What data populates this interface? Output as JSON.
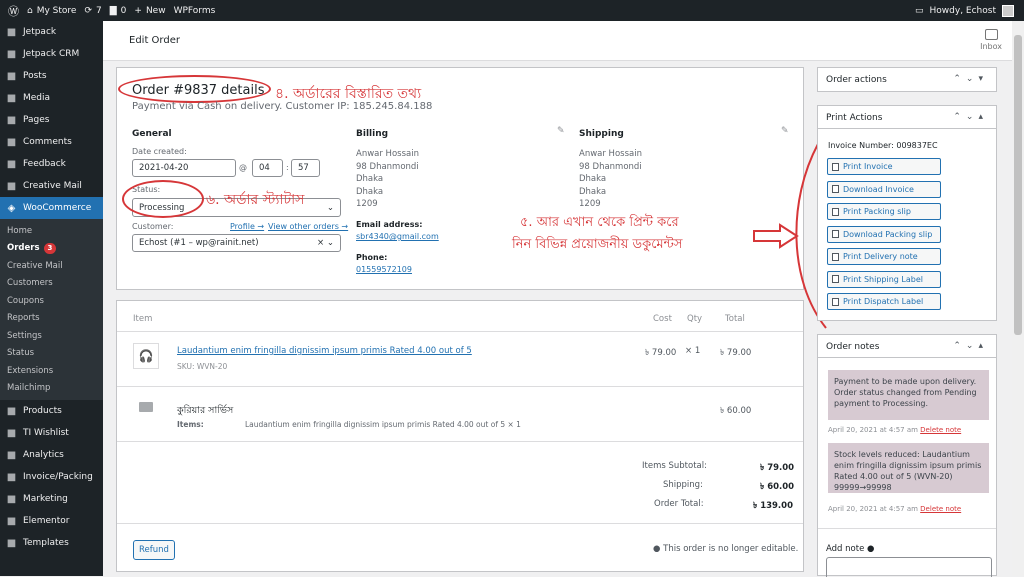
{
  "adminbar": {
    "site": "My Store",
    "updates": "7",
    "comments": "0",
    "new": "New",
    "wpforms": "WPForms",
    "howdy": "Howdy, Echost"
  },
  "sidebar": {
    "top": [
      {
        "label": "Jetpack",
        "icon": "jetpack-icon"
      },
      {
        "label": "Jetpack CRM",
        "icon": "crm-icon"
      },
      {
        "label": "Posts",
        "icon": "pin-icon"
      },
      {
        "label": "Media",
        "icon": "media-icon"
      },
      {
        "label": "Pages",
        "icon": "page-icon"
      },
      {
        "label": "Comments",
        "icon": "comment-icon"
      },
      {
        "label": "Feedback",
        "icon": "feedback-icon"
      },
      {
        "label": "Creative Mail",
        "icon": "cm-icon"
      }
    ],
    "woo": "WooCommerce",
    "subs": [
      "Home",
      "Orders",
      "Creative Mail",
      "Customers",
      "Coupons",
      "Reports",
      "Settings",
      "Status",
      "Extensions",
      "Mailchimp"
    ],
    "orders_badge": "3",
    "bottom": [
      {
        "label": "Products",
        "icon": "box-icon"
      },
      {
        "label": "TI Wishlist",
        "icon": "heart-icon"
      },
      {
        "label": "Analytics",
        "icon": "chart-icon"
      },
      {
        "label": "Invoice/Packing",
        "icon": "invoice-icon"
      },
      {
        "label": "Marketing",
        "icon": "megaphone-icon"
      },
      {
        "label": "Elementor",
        "icon": "elementor-icon"
      },
      {
        "label": "Templates",
        "icon": "folder-icon"
      }
    ]
  },
  "header": {
    "title": "Edit Order",
    "inbox": "Inbox"
  },
  "order": {
    "title": "Order #9837 details",
    "subtitle": "Payment via Cash on delivery. Customer IP: 185.245.84.188",
    "general": "General",
    "date_label": "Date created:",
    "date": "2021-04-20",
    "hour": "04",
    "minute": "57",
    "at": "@",
    "status_label": "Status:",
    "status": "Processing",
    "customer_label": "Customer:",
    "profile": "Profile →",
    "view_other": "View other orders →",
    "customer": "Echost (#1 – wp@rainit.net)",
    "billing": "Billing",
    "billing_lines": [
      "Anwar Hossain",
      "98 Dhanmondi",
      "Dhaka",
      "Dhaka",
      "1209"
    ],
    "email_label": "Email address:",
    "email": "sbr4340@gmail.com",
    "phone_label": "Phone:",
    "phone": "01559572109",
    "shipping": "Shipping",
    "shipping_lines": [
      "Anwar Hossain",
      "98 Dhanmondi",
      "Dhaka",
      "Dhaka",
      "1209"
    ]
  },
  "annotations": {
    "a4": "৪. অর্ডারের বিস্তারিত তথ্য",
    "a6": "৬. অর্ডার স্ট্যাটাস",
    "a5_1": "৫. আর এখান থেকে প্রিন্ট করে",
    "a5_2": "নিন বিভিন্ন প্রয়োজনীয় ডকুমেন্টস"
  },
  "items": {
    "headers": {
      "item": "Item",
      "cost": "Cost",
      "qty": "Qty",
      "total": "Total"
    },
    "product": {
      "name": "Laudantium enim fringilla dignissim ipsum primis Rated 4.00 out of 5",
      "sku": "SKU: WVN-20",
      "cost": "৳ 79.00",
      "qty": "× 1",
      "total": "৳ 79.00"
    },
    "shipping": {
      "name": "কুরিয়ার সার্ভিস",
      "items_label": "Items:",
      "items_value": "Laudantium enim fringilla dignissim ipsum primis Rated 4.00 out of 5 × 1",
      "total": "৳ 60.00"
    },
    "totals": [
      {
        "label": "Items Subtotal:",
        "value": "৳ 79.00"
      },
      {
        "label": "Shipping:",
        "value": "৳ 60.00"
      },
      {
        "label": "Order Total:",
        "value": "৳ 139.00"
      }
    ],
    "refund": "Refund",
    "not_editable": "This order is no longer editable."
  },
  "order_actions": {
    "title": "Order actions"
  },
  "print_actions": {
    "title": "Print Actions",
    "invoice_label": "Invoice Number:",
    "invoice_number": "009837EC",
    "buttons": [
      "Print Invoice",
      "Download Invoice",
      "Print Packing slip",
      "Download Packing slip",
      "Print Delivery note",
      "Print Shipping Label",
      "Print Dispatch Label"
    ]
  },
  "order_notes": {
    "title": "Order notes",
    "notes": [
      {
        "text": "Payment to be made upon delivery. Order status changed from Pending payment to Processing.",
        "date": "April 20, 2021 at 4:57 am",
        "delete": "Delete note"
      },
      {
        "text": "Stock levels reduced: Laudantium enim fringilla dignissim ipsum primis Rated 4.00 out of 5 (WVN-20) 99999→99998",
        "date": "April 20, 2021 at 4:57 am",
        "delete": "Delete note"
      }
    ],
    "add_note": "Add note"
  },
  "colors": {
    "accent": "#2271b1",
    "annotation": "#d63638",
    "sidebar": "#1d2327"
  }
}
